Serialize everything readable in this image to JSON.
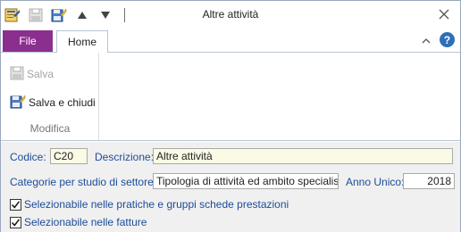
{
  "window": {
    "title": "Altre attività"
  },
  "tabs": {
    "file": "File",
    "home": "Home"
  },
  "ribbon": {
    "save_label": "Salva",
    "save_close_label": "Salva e chiudi",
    "group_label": "Modifica"
  },
  "form": {
    "codice_label": "Codice:",
    "codice_value": "C20",
    "descrizione_label": "Descrizione:",
    "descrizione_value": "Altre attività",
    "categorie_label": "Categorie per studio di settore:",
    "categorie_value": "Tipologia di attività ed ambito specialistico",
    "anno_label": "Anno Unico:",
    "anno_value": "2018",
    "check1_label": "Selezionabile nelle pratiche e gruppi schede prestazioni",
    "check1_checked": true,
    "check2_label": "Selezionabile nelle fatture",
    "check2_checked": true
  },
  "colors": {
    "file_tab": "#8b2f8f",
    "label_blue": "#1c4c9a",
    "help_blue": "#2f6fb8",
    "field_yellow": "#fbfbe5"
  },
  "icons": {
    "app": "app-icon",
    "save": "save-icon",
    "save_close": "save-close-icon",
    "up": "arrow-up-icon",
    "down": "arrow-down-icon",
    "close": "close-icon",
    "collapse": "collapse-ribbon-icon",
    "help": "help-icon"
  }
}
